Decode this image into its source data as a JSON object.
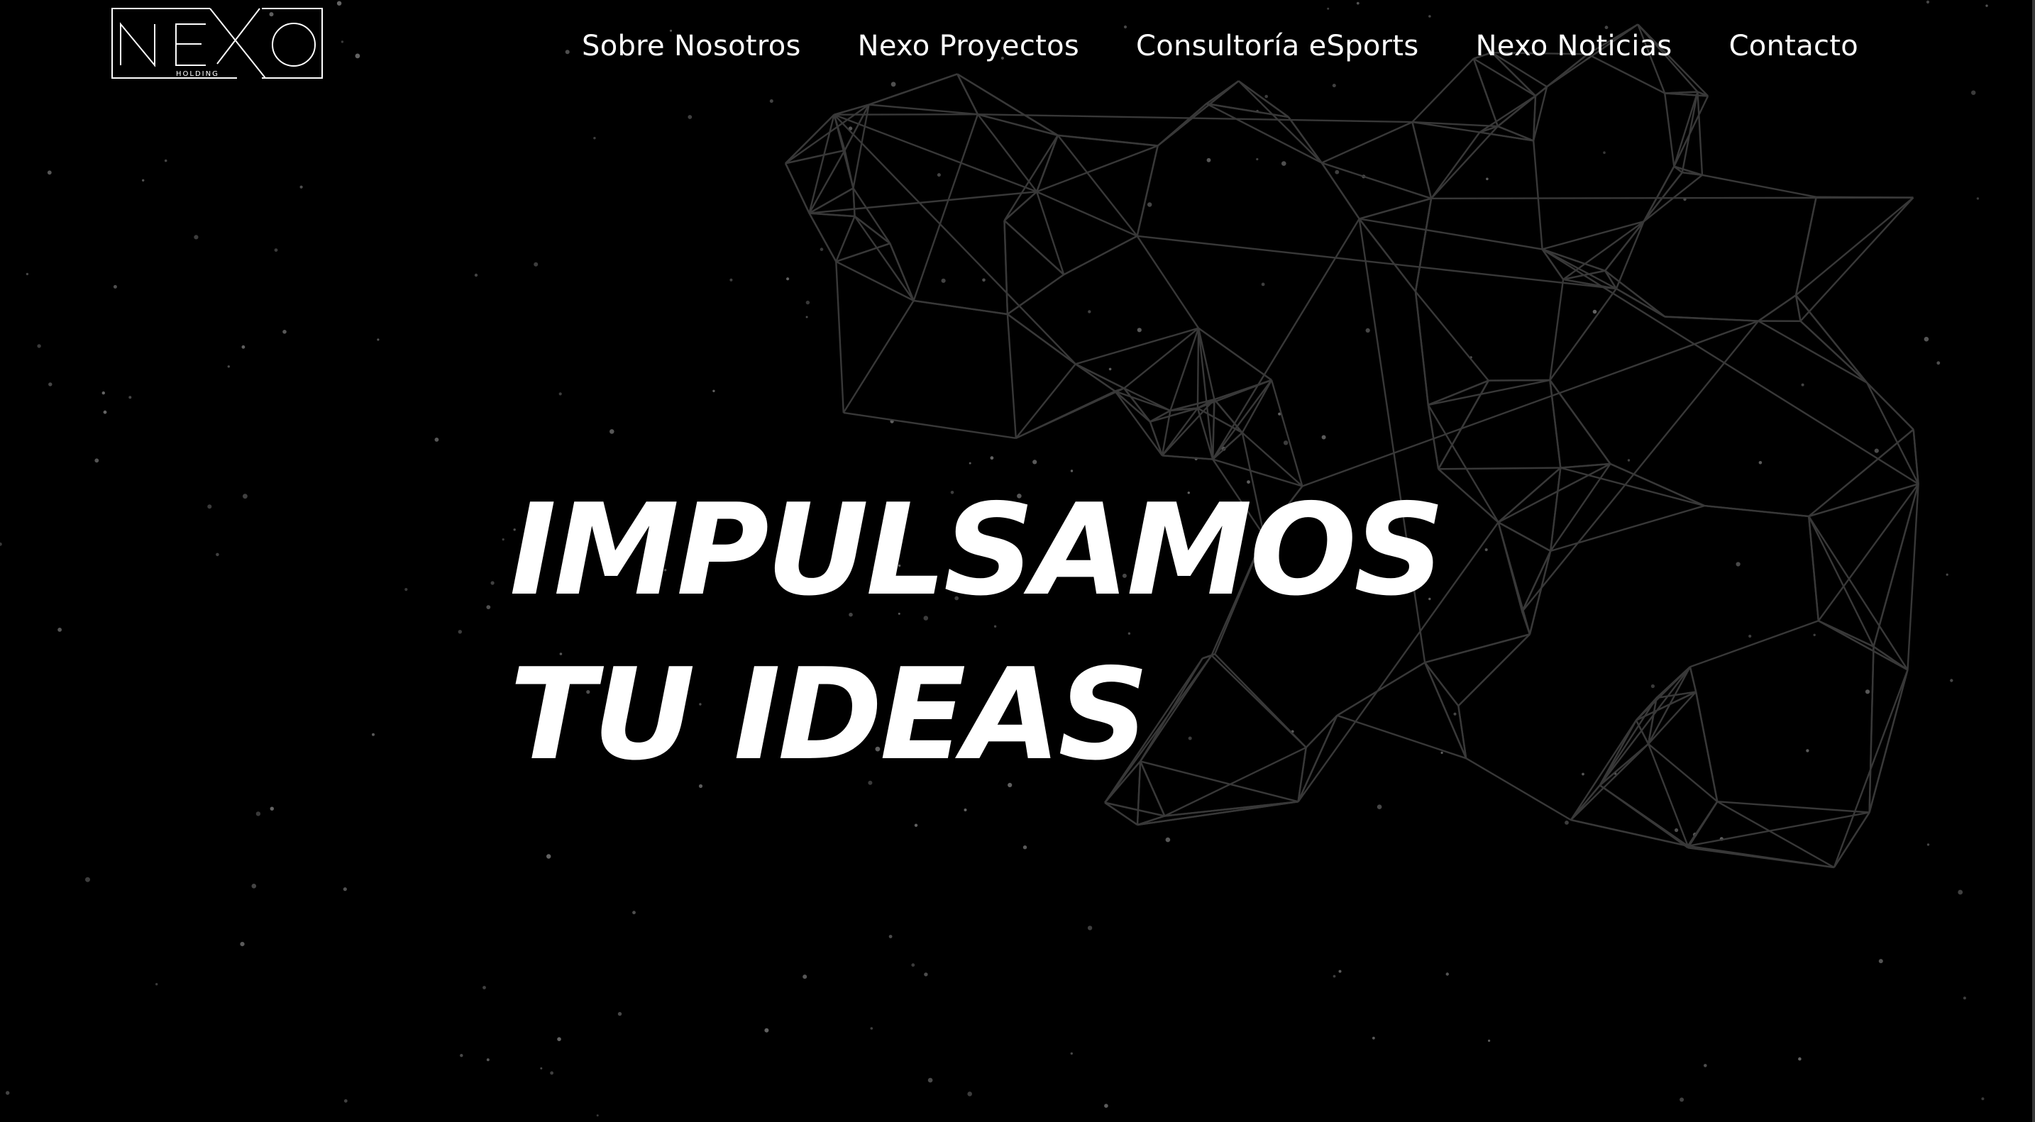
{
  "logo": {
    "wordmark": "NEXO",
    "tagline": "HOLDING"
  },
  "nav": {
    "items": [
      {
        "label": "Sobre Nosotros"
      },
      {
        "label": "Nexo Proyectos"
      },
      {
        "label": "Consultoría eSports"
      },
      {
        "label": "Nexo Noticias"
      },
      {
        "label": "Contacto"
      }
    ]
  },
  "hero": {
    "line1": "IMPULSAMOS",
    "line2": "TU IDEAS"
  },
  "colors": {
    "background": "#000000",
    "text": "#ffffff",
    "network_lines": "#3c3c3c",
    "stars": "#6f6f6f"
  }
}
